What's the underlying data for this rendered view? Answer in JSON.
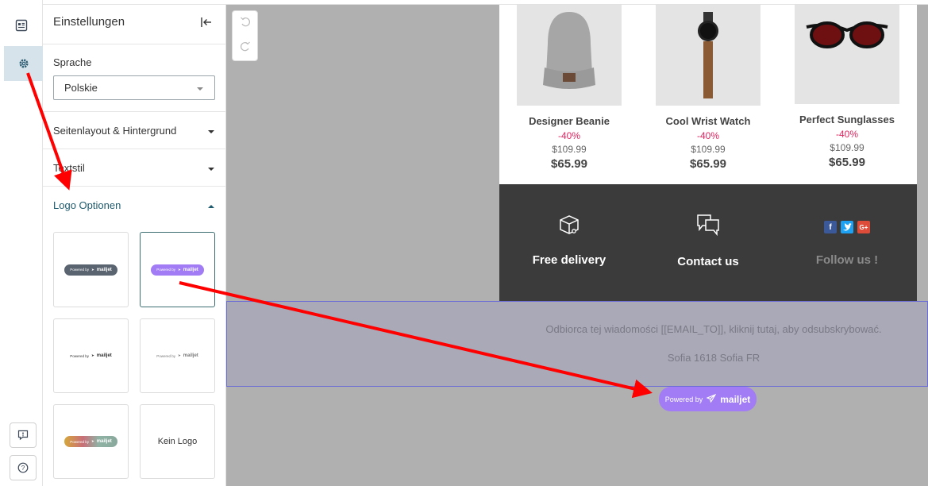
{
  "panel": {
    "title": "Einstellungen",
    "language_label": "Sprache",
    "language_value": "Polskie",
    "sections": [
      {
        "label": "Seitenlayout & Hintergrund",
        "state": "collapsed"
      },
      {
        "label": "Textstil",
        "state": "collapsed"
      },
      {
        "label": "Logo Optionen",
        "state": "expanded"
      }
    ],
    "logo_options": [
      {
        "style": "dark-pill",
        "text": "Powered by",
        "brand": "mailjet",
        "selected": false
      },
      {
        "style": "purple-pill",
        "text": "Powered by",
        "brand": "mailjet",
        "selected": true
      },
      {
        "style": "plain-black",
        "text": "Powered by",
        "brand": "mailjet",
        "selected": false
      },
      {
        "style": "plain-grey",
        "text": "Powered by",
        "brand": "mailjet",
        "selected": false
      },
      {
        "style": "gradient-pill",
        "text": "Powered by",
        "brand": "mailjet",
        "selected": false
      },
      {
        "style": "none",
        "text": "Kein Logo",
        "selected": false
      }
    ]
  },
  "rail": {
    "icons": [
      "content-icon",
      "settings-icon",
      "feedback-icon",
      "help-icon"
    ],
    "active": "settings-icon"
  },
  "toolbar": {
    "icons": [
      "undo-icon",
      "redo-icon"
    ]
  },
  "products": [
    {
      "name": "Designer Beanie",
      "discount": "-40%",
      "old_price": "$109.99",
      "price": "$65.99"
    },
    {
      "name": "Cool Wrist Watch",
      "discount": "-40%",
      "old_price": "$109.99",
      "price": "$65.99"
    },
    {
      "name": "Perfect Sunglasses",
      "discount": "-40%",
      "old_price": "$109.99",
      "price": "$65.99"
    }
  ],
  "features": [
    {
      "title": "Free delivery",
      "icon": "delivery-box-icon"
    },
    {
      "title": "Contact us",
      "icon": "chat-bubbles-icon"
    },
    {
      "title": "Follow us !",
      "icons": [
        "f",
        "t",
        "G+"
      ]
    }
  ],
  "footer": {
    "unsubscribe": "Odbiorca tej wiadomości [[EMAIL_TO]], kliknij tutaj, aby odsubskrybować.",
    "address": "Sofia 1618 Sofia FR"
  },
  "powered_badge": {
    "text": "Powered by",
    "brand": "mailjet"
  },
  "colors": {
    "accent": "#a17cf5",
    "discount": "#e0245e",
    "dark_band": "#3b3b3b",
    "active_section": "#1f5b6e",
    "annotation_arrow": "#ff0000"
  }
}
